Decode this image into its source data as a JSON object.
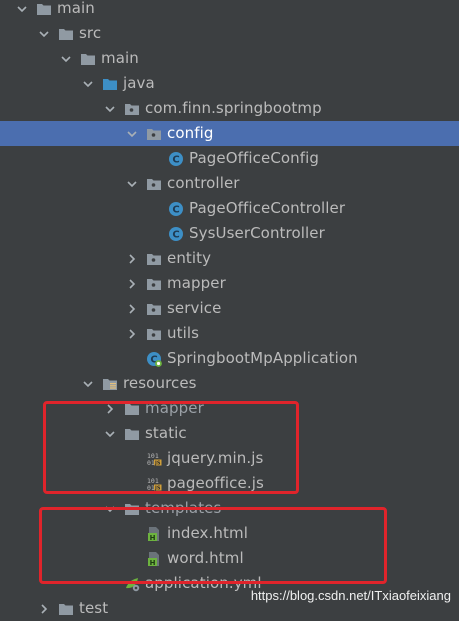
{
  "tree": [
    {
      "label": "main",
      "icon": "folder-icon",
      "state": "expanded",
      "depth": 0
    },
    {
      "label": "src",
      "icon": "folder-icon",
      "state": "expanded",
      "depth": 1
    },
    {
      "label": "main",
      "icon": "folder-icon",
      "state": "expanded",
      "depth": 2
    },
    {
      "label": "java",
      "icon": "source-folder-icon",
      "state": "expanded",
      "depth": 3
    },
    {
      "label": "com.finn.springbootmp",
      "icon": "package-icon",
      "state": "expanded",
      "depth": 4
    },
    {
      "label": "config",
      "icon": "package-icon",
      "state": "expanded",
      "depth": 5,
      "selected": true
    },
    {
      "label": "PageOfficeConfig",
      "icon": "java-class-icon",
      "state": "leaf",
      "depth": 6
    },
    {
      "label": "controller",
      "icon": "package-icon",
      "state": "expanded",
      "depth": 5
    },
    {
      "label": "PageOfficeController",
      "icon": "java-class-icon",
      "state": "leaf",
      "depth": 6
    },
    {
      "label": "SysUserController",
      "icon": "java-class-icon",
      "state": "leaf",
      "depth": 6
    },
    {
      "label": "entity",
      "icon": "package-icon",
      "state": "collapsed",
      "depth": 5
    },
    {
      "label": "mapper",
      "icon": "package-icon",
      "state": "collapsed",
      "depth": 5
    },
    {
      "label": "service",
      "icon": "package-icon",
      "state": "collapsed",
      "depth": 5
    },
    {
      "label": "utils",
      "icon": "package-icon",
      "state": "collapsed",
      "depth": 5
    },
    {
      "label": "SpringbootMpApplication",
      "icon": "spring-boot-app-icon",
      "state": "leaf",
      "depth": 5
    },
    {
      "label": "resources",
      "icon": "resources-folder-icon",
      "state": "expanded",
      "depth": 3
    },
    {
      "label": "mapper",
      "icon": "folder-icon",
      "state": "collapsed",
      "depth": 4,
      "clipped": true
    },
    {
      "label": "static",
      "icon": "folder-icon",
      "state": "expanded",
      "depth": 4
    },
    {
      "label": "jquery.min.js",
      "icon": "js-file-icon",
      "state": "leaf",
      "depth": 5
    },
    {
      "label": "pageoffice.js",
      "icon": "js-file-icon",
      "state": "leaf",
      "depth": 5
    },
    {
      "label": "templates",
      "icon": "folder-icon",
      "state": "expanded",
      "depth": 4,
      "clipped": true
    },
    {
      "label": "index.html",
      "icon": "html-file-icon",
      "state": "leaf",
      "depth": 5
    },
    {
      "label": "word.html",
      "icon": "html-file-icon",
      "state": "leaf",
      "depth": 5
    },
    {
      "label": "application.yml",
      "icon": "yaml-file-icon",
      "state": "leaf",
      "depth": 4
    },
    {
      "label": "test",
      "icon": "folder-icon",
      "state": "collapsed",
      "depth": 1
    }
  ],
  "watermark": "https://blog.csdn.net/ITxiaofeixiang",
  "colors": {
    "background": "#3c3f41",
    "selection": "#4b6eaf",
    "text": "#bbbbbb",
    "folder": "#909aa3",
    "java_class": "#3d8fc6",
    "annotation_box": "#e0242b"
  }
}
